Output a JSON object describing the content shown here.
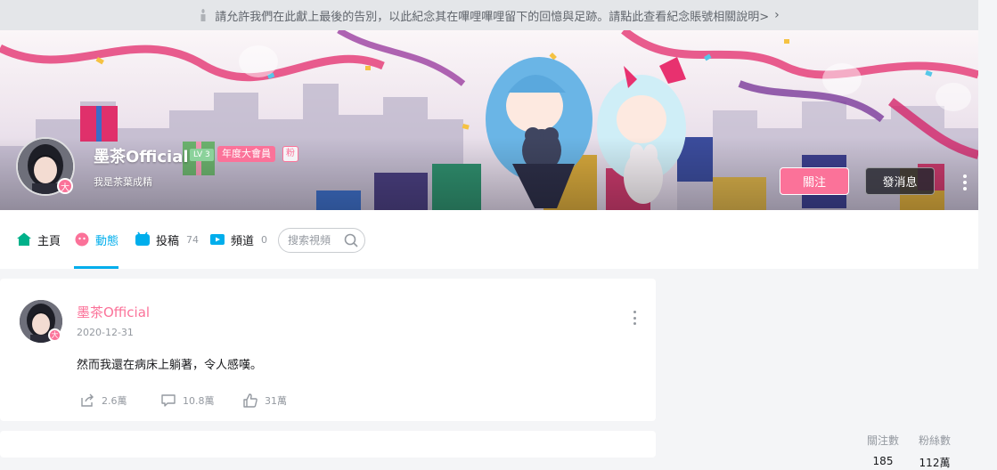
{
  "notice": {
    "text": "請允許我們在此獻上最後的告別，以此紀念其在嗶哩嗶哩留下的回憶與足跡。請點此查看紀念賬號相關說明>",
    "chevron": "›",
    "icon": "candle-icon"
  },
  "profile": {
    "name": "墨茶Official",
    "level": "LV 3",
    "vip_label": "年度大會員",
    "fan_label": "粉",
    "sign": "我是茶葉成精",
    "avatar_badge": "大",
    "follow_label": "關注",
    "message_label": "發消息"
  },
  "nav": {
    "items": [
      {
        "label": "主頁",
        "count": "",
        "icon": "home-icon"
      },
      {
        "label": "動態",
        "count": "",
        "icon": "dynamic-icon"
      },
      {
        "label": "投稿",
        "count": "74",
        "icon": "video-upload-icon"
      },
      {
        "label": "頻道",
        "count": "0",
        "icon": "channel-icon"
      }
    ],
    "active": "動態",
    "search_placeholder": "搜索視頻"
  },
  "stats": {
    "following_label": "關注數",
    "following_value": "185",
    "fans_label": "粉絲數",
    "fans_value": "112萬"
  },
  "post": {
    "author": "墨茶Official",
    "date": "2020-12-31",
    "text": "然而我還在病床上躺著，令人感嘆。",
    "share_count": "2.6萬",
    "comment_count": "10.8萬",
    "like_count": "31萬",
    "avatar_badge": "大"
  },
  "colors": {
    "accent": "#00aeec",
    "pink": "#fb7299",
    "muted": "#9499a0"
  }
}
